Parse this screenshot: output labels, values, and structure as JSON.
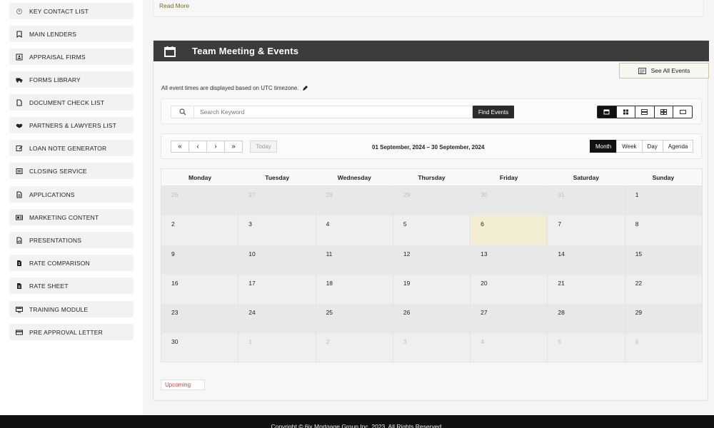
{
  "sidebar": {
    "items": [
      {
        "label": "KEY CONTACT LIST",
        "icon": "contact-icon"
      },
      {
        "label": "MAIN LENDERS",
        "icon": "bookmark-icon"
      },
      {
        "label": "APPRAISAL FIRMS",
        "icon": "id-card-icon"
      },
      {
        "label": "FORMS LIBRARY",
        "icon": "truck-icon"
      },
      {
        "label": "DOCUMENT CHECK LIST",
        "icon": "document-icon"
      },
      {
        "label": "PARTNERS & LAWYERS LIST",
        "icon": "handshake-icon"
      },
      {
        "label": "LOAN NOTE GENERATOR",
        "icon": "note-edit-icon"
      },
      {
        "label": "CLOSING SERVICE",
        "icon": "list-box-icon"
      },
      {
        "label": "APPLICATIONS",
        "icon": "file-text-icon"
      },
      {
        "label": "MARKETING CONTENT",
        "icon": "media-icon"
      },
      {
        "label": "PRESENTATIONS",
        "icon": "file-chart-icon"
      },
      {
        "label": "RATE COMPARISON",
        "icon": "file-dollar-icon"
      },
      {
        "label": "RATE SHEET",
        "icon": "sheet-icon"
      },
      {
        "label": "TRAINING MODULE",
        "icon": "monitor-icon"
      },
      {
        "label": "PRE APPROVAL LETTER",
        "icon": "card-icon"
      }
    ]
  },
  "top_card": {
    "read_more": "Read More"
  },
  "events": {
    "title": "Team Meeting & Events",
    "see_all": "See All Events",
    "timezone_note": "All event times are displayed based on UTC timezone.",
    "search": {
      "placeholder": "Search Keyword",
      "find_label": "Find Events"
    },
    "view_icons": [
      "calendar-view-icon",
      "grid-view-icon",
      "list-view-icon",
      "tiles-view-icon",
      "single-view-icon"
    ],
    "nav": {
      "first": "«",
      "prev": "‹",
      "next": "›",
      "last": "»",
      "today": "Today"
    },
    "range": "01 September, 2024 – 30 September, 2024",
    "modes": [
      "Month",
      "Week",
      "Day",
      "Agenda"
    ],
    "active_mode": "Month",
    "day_names": [
      "Monday",
      "Tuesday",
      "Wednesday",
      "Thursday",
      "Friday",
      "Saturday",
      "Sunday"
    ],
    "weeks": [
      [
        "26",
        "27",
        "28",
        "29",
        "30",
        "31",
        "1"
      ],
      [
        "2",
        "3",
        "4",
        "5",
        "6",
        "7",
        "8"
      ],
      [
        "9",
        "10",
        "11",
        "12",
        "13",
        "14",
        "15"
      ],
      [
        "16",
        "17",
        "18",
        "19",
        "20",
        "21",
        "22"
      ],
      [
        "23",
        "24",
        "25",
        "26",
        "27",
        "28",
        "29"
      ],
      [
        "30",
        "1",
        "2",
        "3",
        "4",
        "5",
        "6"
      ]
    ],
    "upcoming": "Upcoming"
  },
  "footer": {
    "copyright": "Copyright © 6ix Mortgage Group Inc. 2023. All Rights Reserved."
  },
  "colors": {
    "header_bg": "#3c3c3c",
    "today_bg": "#f3edd3",
    "accent": "#7a6a1f",
    "upcoming_text": "#c6443a"
  }
}
